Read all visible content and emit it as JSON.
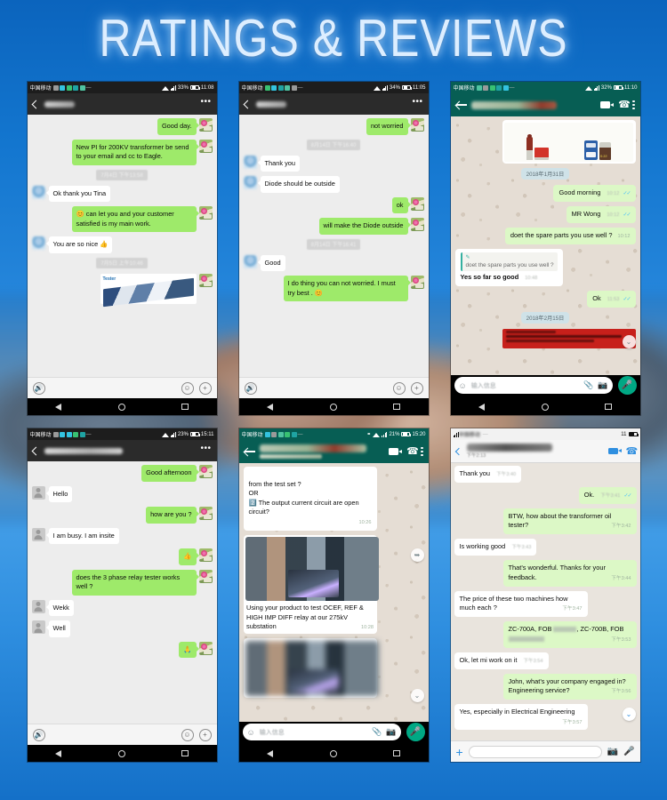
{
  "title": "RATINGS & REVIEWS",
  "accent_colors": {
    "page_blue": "#1376cf",
    "title_glow": "#ddeeff",
    "wechat_out_bubble": "#9eea6a",
    "wechat_bg": "#ededed",
    "whatsapp_header": "#075e54",
    "whatsapp_out_bubble": "#dcf8c6",
    "whatsapp_bg": "#e5ddd4",
    "whatsapp_mic": "#00a884",
    "ios_accent": "#2f8fe0"
  },
  "phones": [
    {
      "id": "phone-1",
      "app": "wechat",
      "status": {
        "carrier": "中国移动",
        "battery": "33%",
        "time": "11:08"
      },
      "header": {
        "contact": "",
        "menu": "•••"
      },
      "messages": [
        {
          "side": "right",
          "type": "text",
          "text": "Good day."
        },
        {
          "side": "right",
          "type": "text",
          "text": "New PI for 200KV transformer be send to your email and cc to Eagle."
        },
        {
          "side": "divider",
          "text": "7月4日 下午13:58"
        },
        {
          "side": "left",
          "type": "text",
          "text": "Ok thank you Tina"
        },
        {
          "side": "right",
          "type": "text",
          "text": "😊 can let you and your customer satisfied is my main work."
        },
        {
          "side": "left",
          "type": "text",
          "text": "You are so nice 👍"
        },
        {
          "side": "divider",
          "text": "7月5日 上午10:46"
        },
        {
          "side": "right",
          "type": "card",
          "logo": "Tester",
          "text": ""
        }
      ],
      "input": {
        "voice": "voice-icon",
        "emoji": "emoji-icon",
        "plus": "+"
      }
    },
    {
      "id": "phone-2",
      "app": "wechat",
      "status": {
        "carrier": "中国移动",
        "battery": "34%",
        "time": "11:05"
      },
      "header": {
        "contact": "",
        "menu": "•••"
      },
      "messages": [
        {
          "side": "right",
          "type": "text",
          "text": "not worried"
        },
        {
          "side": "divider",
          "text": "8月14日 下午16:40"
        },
        {
          "side": "left",
          "type": "text",
          "text": "Thank you"
        },
        {
          "side": "left",
          "type": "text",
          "text": "Diode should be outside"
        },
        {
          "side": "right",
          "type": "text",
          "text": "ok"
        },
        {
          "side": "right",
          "type": "text",
          "text": "will make the Diode outside"
        },
        {
          "side": "divider",
          "text": "8月14日 下午16:41"
        },
        {
          "side": "left",
          "type": "text",
          "text": "Good"
        },
        {
          "side": "right",
          "type": "text",
          "text": "I do thing you can not worried. I must try best . 😊"
        }
      ],
      "input": {
        "voice": "voice-icon",
        "emoji": "emoji-icon",
        "plus": "+"
      }
    },
    {
      "id": "phone-3",
      "app": "whatsapp",
      "status": {
        "carrier": "中国移动",
        "battery": "32%",
        "time": "11:10"
      },
      "header": {
        "contact": "",
        "video": "video-call-icon",
        "call": "call-icon",
        "menu": "overflow-icon"
      },
      "messages": [
        {
          "side": "right",
          "type": "product-image"
        },
        {
          "side": "divider",
          "text": "2018年1月31日"
        },
        {
          "side": "right",
          "type": "text",
          "text": "Good morning",
          "time": "10:12",
          "ticks": "✓✓"
        },
        {
          "side": "right",
          "type": "text",
          "text": "MR Wong",
          "time": "10:12",
          "ticks": "✓✓"
        },
        {
          "side": "right",
          "type": "text",
          "text": "doet the spare parts you use well ?",
          "time": "10:12",
          "ticks": "✓✓"
        },
        {
          "side": "left",
          "type": "quoted",
          "quote_text": "doet the spare parts you use well ?",
          "text": "Yes so far so good",
          "time": "10:48"
        },
        {
          "side": "right",
          "type": "text",
          "text": "Ok",
          "time": "11:53",
          "ticks": "✓✓"
        },
        {
          "side": "divider",
          "text": "2018年2月15日"
        },
        {
          "side": "right",
          "type": "red-banner"
        }
      ],
      "input": {
        "placeholder": "输入信息",
        "emoji": "emoji-icon",
        "attach": "paperclip-icon",
        "camera": "camera-icon",
        "mic": "mic-icon"
      }
    },
    {
      "id": "phone-4",
      "app": "wechat",
      "status": {
        "carrier": "中国移动",
        "battery": "23%",
        "time": "15:11"
      },
      "header": {
        "contact": "",
        "menu": "•••"
      },
      "messages": [
        {
          "side": "right",
          "type": "text",
          "text": "Good afternoon"
        },
        {
          "side": "left",
          "type": "text",
          "text": "Hello"
        },
        {
          "side": "right",
          "type": "text",
          "text": "how are you ?"
        },
        {
          "side": "left",
          "type": "text",
          "text": "I am busy. I am insite"
        },
        {
          "side": "right",
          "type": "text",
          "text": "👍"
        },
        {
          "side": "right",
          "type": "text",
          "text": "does the 3 phase relay tester works well ?"
        },
        {
          "side": "left",
          "type": "text",
          "text": "Wekk"
        },
        {
          "side": "left",
          "type": "text",
          "text": "Well"
        },
        {
          "side": "right",
          "type": "text",
          "text": "🙏"
        }
      ],
      "input": {
        "voice": "voice-icon",
        "emoji": "emoji-icon",
        "plus": "+"
      }
    },
    {
      "id": "phone-5",
      "app": "whatsapp",
      "status": {
        "carrier": "中国移动",
        "battery": "21%",
        "time": "15:20"
      },
      "header": {
        "contact": "",
        "subtitle": "14:14",
        "video": "video-call-icon",
        "call": "call-icon",
        "menu": "overflow-icon"
      },
      "messages": [
        {
          "side": "left",
          "type": "text",
          "text": "from the test set ?\nOR\n2️⃣ The output current circuit are open circuit?",
          "time": "10:26"
        },
        {
          "side": "left",
          "type": "image-caption",
          "text": "Using your product to test OCEF, REF & HIGH IMP DIFF relay at our 275kV substation",
          "time": "10:28"
        },
        {
          "side": "left",
          "type": "image-blurred"
        }
      ],
      "input": {
        "placeholder": "输入信息",
        "emoji": "emoji-icon",
        "attach": "paperclip-icon",
        "camera": "camera-icon",
        "mic": "mic-icon"
      }
    },
    {
      "id": "phone-6",
      "app": "whatsapp-ios",
      "status": {
        "carrier": "中国移动",
        "time": "11"
      },
      "header": {
        "contact": "",
        "subtitle": "下午2:13",
        "video": "video-call-icon",
        "call": "call-icon"
      },
      "messages": [
        {
          "side": "left",
          "type": "text",
          "text": "Thank you",
          "time": "下午3:40"
        },
        {
          "side": "right",
          "type": "text",
          "text": "Ok.",
          "time": "下午3:41",
          "ticks": "✓✓"
        },
        {
          "side": "right",
          "type": "text",
          "text": "BTW, how about the transformer oil tester?",
          "time": "下午3:42",
          "ticks": "✓✓"
        },
        {
          "side": "left",
          "type": "text",
          "text": "Is working good",
          "time": "下午3:43"
        },
        {
          "side": "right",
          "type": "text",
          "text": "That’s wonderful. Thanks for your feedback.",
          "time": "下午3:44",
          "ticks": "✓✓"
        },
        {
          "side": "left",
          "type": "text",
          "text": "The price of these two machines how much each ?",
          "time": "下午3:47"
        },
        {
          "side": "right",
          "type": "redacted-price",
          "prefix": "ZC-700A, FOB ",
          "mid": ", ZC-700B, FOB ",
          "time": "下午3:53",
          "ticks": "✓✓"
        },
        {
          "side": "left",
          "type": "text",
          "text": "Ok, let mi work on it",
          "time": "下午3:54"
        },
        {
          "side": "right",
          "type": "text",
          "text": "John, what’s your company engaged in? Engineering service?",
          "time": "下午3:56",
          "ticks": "✓✓"
        },
        {
          "side": "left",
          "type": "text",
          "text": "Yes, especially in Electrical Engineering",
          "time": "下午3:57"
        }
      ],
      "input": {
        "plus": "+",
        "camera": "camera-icon",
        "mic": "mic-icon"
      }
    }
  ],
  "nav": {
    "back": "back-triangle",
    "home": "home-circle",
    "recents": "recents-square"
  }
}
